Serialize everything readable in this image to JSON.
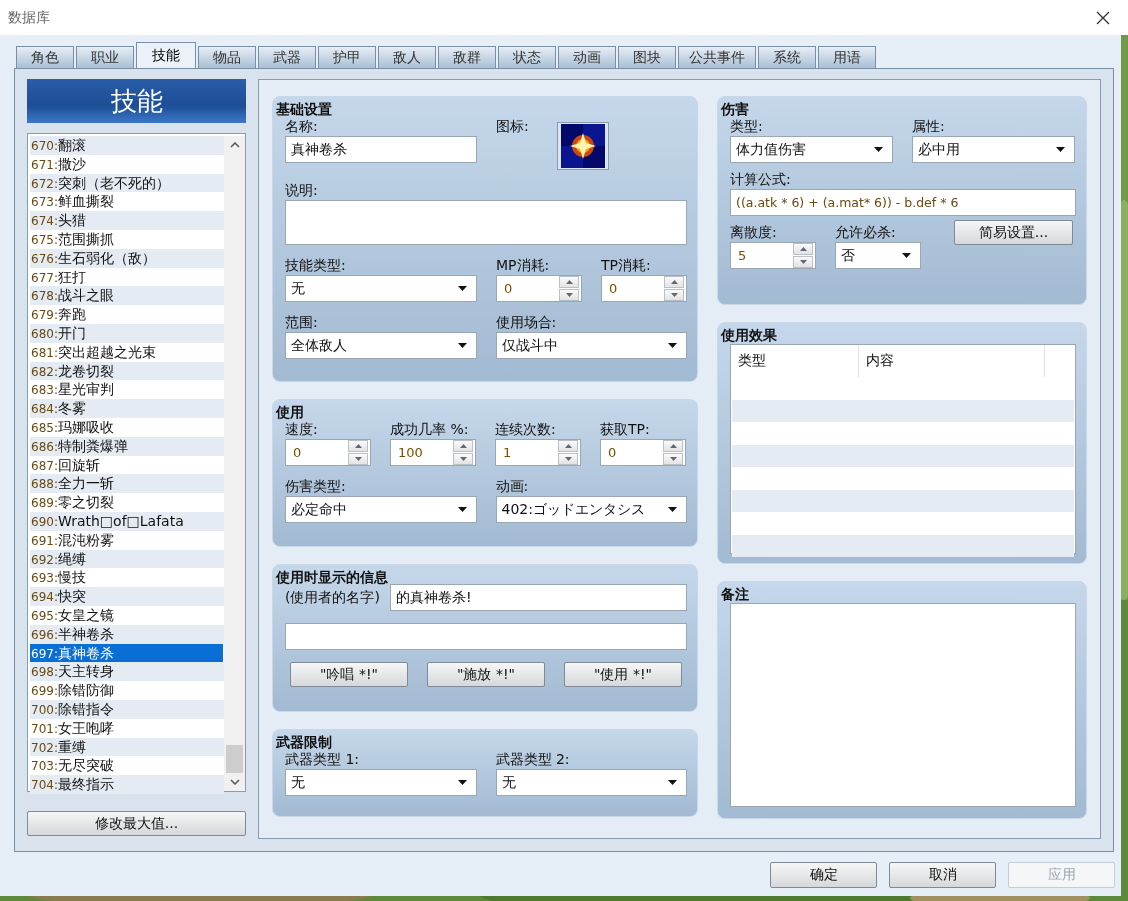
{
  "window": {
    "title": "数据库"
  },
  "tabs": [
    {
      "label": "角色",
      "selected": false
    },
    {
      "label": "职业",
      "selected": false
    },
    {
      "label": "技能",
      "selected": true
    },
    {
      "label": "物品",
      "selected": false
    },
    {
      "label": "武器",
      "selected": false
    },
    {
      "label": "护甲",
      "selected": false
    },
    {
      "label": "敌人",
      "selected": false
    },
    {
      "label": "敌群",
      "selected": false
    },
    {
      "label": "状态",
      "selected": false
    },
    {
      "label": "动画",
      "selected": false
    },
    {
      "label": "图块",
      "selected": false
    },
    {
      "label": "公共事件",
      "selected": false
    },
    {
      "label": "系统",
      "selected": false
    },
    {
      "label": "用语",
      "selected": false
    }
  ],
  "list": {
    "header": "技能",
    "button": "修改最大值...",
    "items": [
      {
        "label": "670:翻滚",
        "selected": false
      },
      {
        "label": "671:撒沙",
        "selected": false
      },
      {
        "label": "672:突刺（老不死的）",
        "selected": false
      },
      {
        "label": "673:鲜血撕裂",
        "selected": false
      },
      {
        "label": "674:头猎",
        "selected": false
      },
      {
        "label": "675:范围撕抓",
        "selected": false
      },
      {
        "label": "676:生石弱化（敌）",
        "selected": false
      },
      {
        "label": "677:狂打",
        "selected": false
      },
      {
        "label": "678:战斗之眼",
        "selected": false
      },
      {
        "label": "679:奔跑",
        "selected": false
      },
      {
        "label": "680:开门",
        "selected": false
      },
      {
        "label": "681:突出超越之光束",
        "selected": false
      },
      {
        "label": "682:龙卷切裂",
        "selected": false
      },
      {
        "label": "683:星光审判",
        "selected": false
      },
      {
        "label": "684:冬雾",
        "selected": false
      },
      {
        "label": "685:玛娜吸收",
        "selected": false
      },
      {
        "label": "686:特制粪爆弹",
        "selected": false
      },
      {
        "label": "687:回旋斩",
        "selected": false
      },
      {
        "label": "688:全力一斩",
        "selected": false
      },
      {
        "label": "689:零之切裂",
        "selected": false
      },
      {
        "label": "690:Wrath□of□Lafata",
        "selected": false
      },
      {
        "label": "691:混沌粉雾",
        "selected": false
      },
      {
        "label": "692:绳缚",
        "selected": false
      },
      {
        "label": "693:慢技",
        "selected": false
      },
      {
        "label": "694:快突",
        "selected": false
      },
      {
        "label": "695:女皇之镜",
        "selected": false
      },
      {
        "label": "696:半神卷杀",
        "selected": false
      },
      {
        "label": "697:真神卷杀",
        "selected": true
      },
      {
        "label": "698:天主转身",
        "selected": false
      },
      {
        "label": "699:除错防御",
        "selected": false
      },
      {
        "label": "700:除错指令",
        "selected": false
      },
      {
        "label": "701:女王咆哮",
        "selected": false
      },
      {
        "label": "702:重缚",
        "selected": false
      },
      {
        "label": "703:无尽突破",
        "selected": false
      },
      {
        "label": "704:最终指示",
        "selected": false
      }
    ]
  },
  "left_sections": [
    {
      "kind": "basic",
      "title": "基础设置",
      "rows": [
        [
          {
            "kind": "text",
            "label": "名称:",
            "value": "真神卷杀"
          },
          "",
          {
            "kind": "icon",
            "label": "图标:"
          }
        ],
        [
          {
            "kind": "textarea",
            "label": "说明:"
          }
        ],
        [
          {
            "kind": "select",
            "label": "技能类型:",
            "value": "无"
          },
          "",
          {
            "kind": "spin",
            "label": "MP消耗:",
            "value": "0"
          },
          {
            "kind": "spin",
            "label": "TP消耗:",
            "value": "0"
          }
        ],
        [
          {
            "kind": "select",
            "label": "范围:",
            "value": "全体敌人"
          },
          "",
          {
            "kind": "select",
            "label": "使用场合:",
            "value": "仅战斗中"
          }
        ]
      ]
    },
    {
      "kind": "use",
      "title": "使用",
      "rows": [
        [
          {
            "kind": "spin",
            "label": "速度:",
            "value": "0"
          },
          {
            "kind": "spin",
            "label": "成功几率 %:",
            "value": "100"
          },
          {
            "kind": "spin",
            "label": "连续次数:",
            "value": "1"
          },
          {
            "kind": "spin",
            "label": "获取TP:",
            "value": "0"
          }
        ],
        [
          {
            "kind": "select",
            "label": "伤害类型:",
            "value": "必定命中"
          },
          "",
          {
            "kind": "select",
            "label": "动画:",
            "value": "402:ゴッドエンタシス"
          }
        ]
      ]
    },
    {
      "kind": "message",
      "title": "使用时显示的信息",
      "rows": [
        [
          {
            "kind": "inline_text",
            "label": "(使用者的名字)",
            "value": "的真神卷杀!"
          }
        ],
        [
          {
            "kind": "wide_text"
          }
        ],
        [
          {
            "kind": "buttons",
            "items": [
              "\"吟唱 *!\"",
              "\"施放 *!\"",
              "\"使用 *!\""
            ]
          }
        ]
      ]
    },
    {
      "kind": "weapon",
      "title": "武器限制",
      "rows": [
        [
          {
            "kind": "select",
            "label": "武器类型 1:",
            "value": "无"
          },
          "",
          {
            "kind": "select",
            "label": "武器类型 2:",
            "value": "无"
          }
        ]
      ]
    }
  ],
  "right_sections": [
    {
      "kind": "damage",
      "title": "伤害",
      "rows": [
        [
          {
            "kind": "select",
            "label": "类型:",
            "value": "体力值伤害"
          },
          {
            "kind": "select",
            "label": "属性:",
            "value": "必中用"
          }
        ],
        [
          {
            "kind": "wide_text",
            "label": "计算公式:",
            "value": "((a.atk * 6) + (a.mat* 6)) - b.def * 6"
          }
        ],
        [
          {
            "kind": "spin",
            "label": "离散度:",
            "value": "5"
          },
          {
            "kind": "select",
            "label": "允许必杀:",
            "value": "否"
          },
          {
            "kind": "button",
            "label": "简易设置..."
          }
        ]
      ]
    },
    {
      "kind": "effects",
      "title": "使用效果",
      "rows": [
        [
          {
            "kind": "table",
            "columns": [
              "类型",
              "内容"
            ]
          }
        ]
      ]
    },
    {
      "kind": "note",
      "title": "备注",
      "rows": [
        [
          {
            "kind": "note_area"
          }
        ]
      ]
    }
  ],
  "footer_buttons": [
    {
      "label": "确定",
      "disabled": false
    },
    {
      "label": "取消",
      "disabled": false
    },
    {
      "label": "应用",
      "disabled": true
    }
  ]
}
